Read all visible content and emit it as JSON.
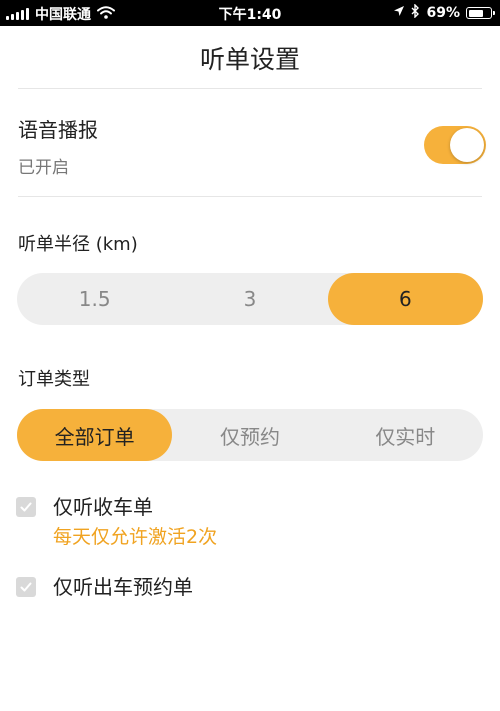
{
  "status_bar": {
    "carrier": "中国联通",
    "time": "下午1:40",
    "battery_percent": "69%",
    "battery_level": 0.69
  },
  "page": {
    "title": "听单设置"
  },
  "voice": {
    "title": "语音播报",
    "status": "已开启",
    "enabled": true
  },
  "radius": {
    "label": "听单半径 (km)",
    "options": [
      "1.5",
      "3",
      "6"
    ],
    "selected": "6"
  },
  "order_type": {
    "label": "订单类型",
    "options": [
      "全部订单",
      "仅预约",
      "仅实时"
    ],
    "selected": "全部订单"
  },
  "checkboxes": [
    {
      "label": "仅听收车单",
      "hint": "每天仅允许激活2次",
      "checked": true
    },
    {
      "label": "仅听出车预约单",
      "checked": true
    }
  ],
  "colors": {
    "accent": "#f6b13b",
    "hint": "#f0a321",
    "segment_bg": "#eeeeee"
  }
}
